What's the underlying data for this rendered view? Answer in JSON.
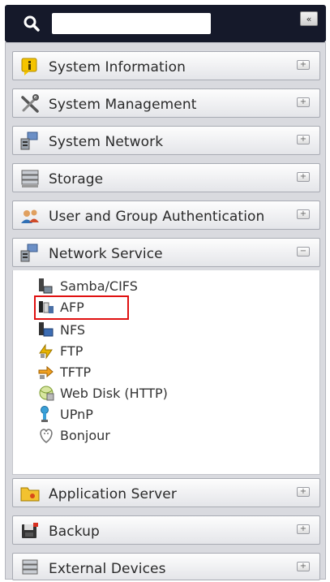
{
  "search": {
    "placeholder": "",
    "value": ""
  },
  "collapse_label": "«",
  "categories": [
    {
      "label": "System Information",
      "icon": "info-icon",
      "toggle": "+"
    },
    {
      "label": "System Management",
      "icon": "tools-icon",
      "toggle": "+"
    },
    {
      "label": "System Network",
      "icon": "network-icon",
      "toggle": "+"
    },
    {
      "label": "Storage",
      "icon": "storage-icon",
      "toggle": "+"
    },
    {
      "label": "User and Group Authentication",
      "icon": "users-icon",
      "toggle": "+"
    },
    {
      "label": "Network Service",
      "icon": "network-service-icon",
      "toggle": "−",
      "expanded": true
    },
    {
      "label": "Application Server",
      "icon": "folder-icon",
      "toggle": "+"
    },
    {
      "label": "Backup",
      "icon": "backup-icon",
      "toggle": "+"
    },
    {
      "label": "External Devices",
      "icon": "external-devices-icon",
      "toggle": "+"
    }
  ],
  "network_service_items": [
    {
      "label": "Samba/CIFS",
      "icon": "samba-icon"
    },
    {
      "label": "AFP",
      "icon": "afp-icon",
      "highlighted": true
    },
    {
      "label": "NFS",
      "icon": "nfs-icon"
    },
    {
      "label": "FTP",
      "icon": "ftp-icon"
    },
    {
      "label": "TFTP",
      "icon": "tftp-icon"
    },
    {
      "label": "Web Disk (HTTP)",
      "icon": "web-disk-icon"
    },
    {
      "label": "UPnP",
      "icon": "upnp-icon"
    },
    {
      "label": "Bonjour",
      "icon": "bonjour-icon"
    }
  ],
  "colors": {
    "highlight": "#e01010",
    "topbar": "#15192a"
  }
}
